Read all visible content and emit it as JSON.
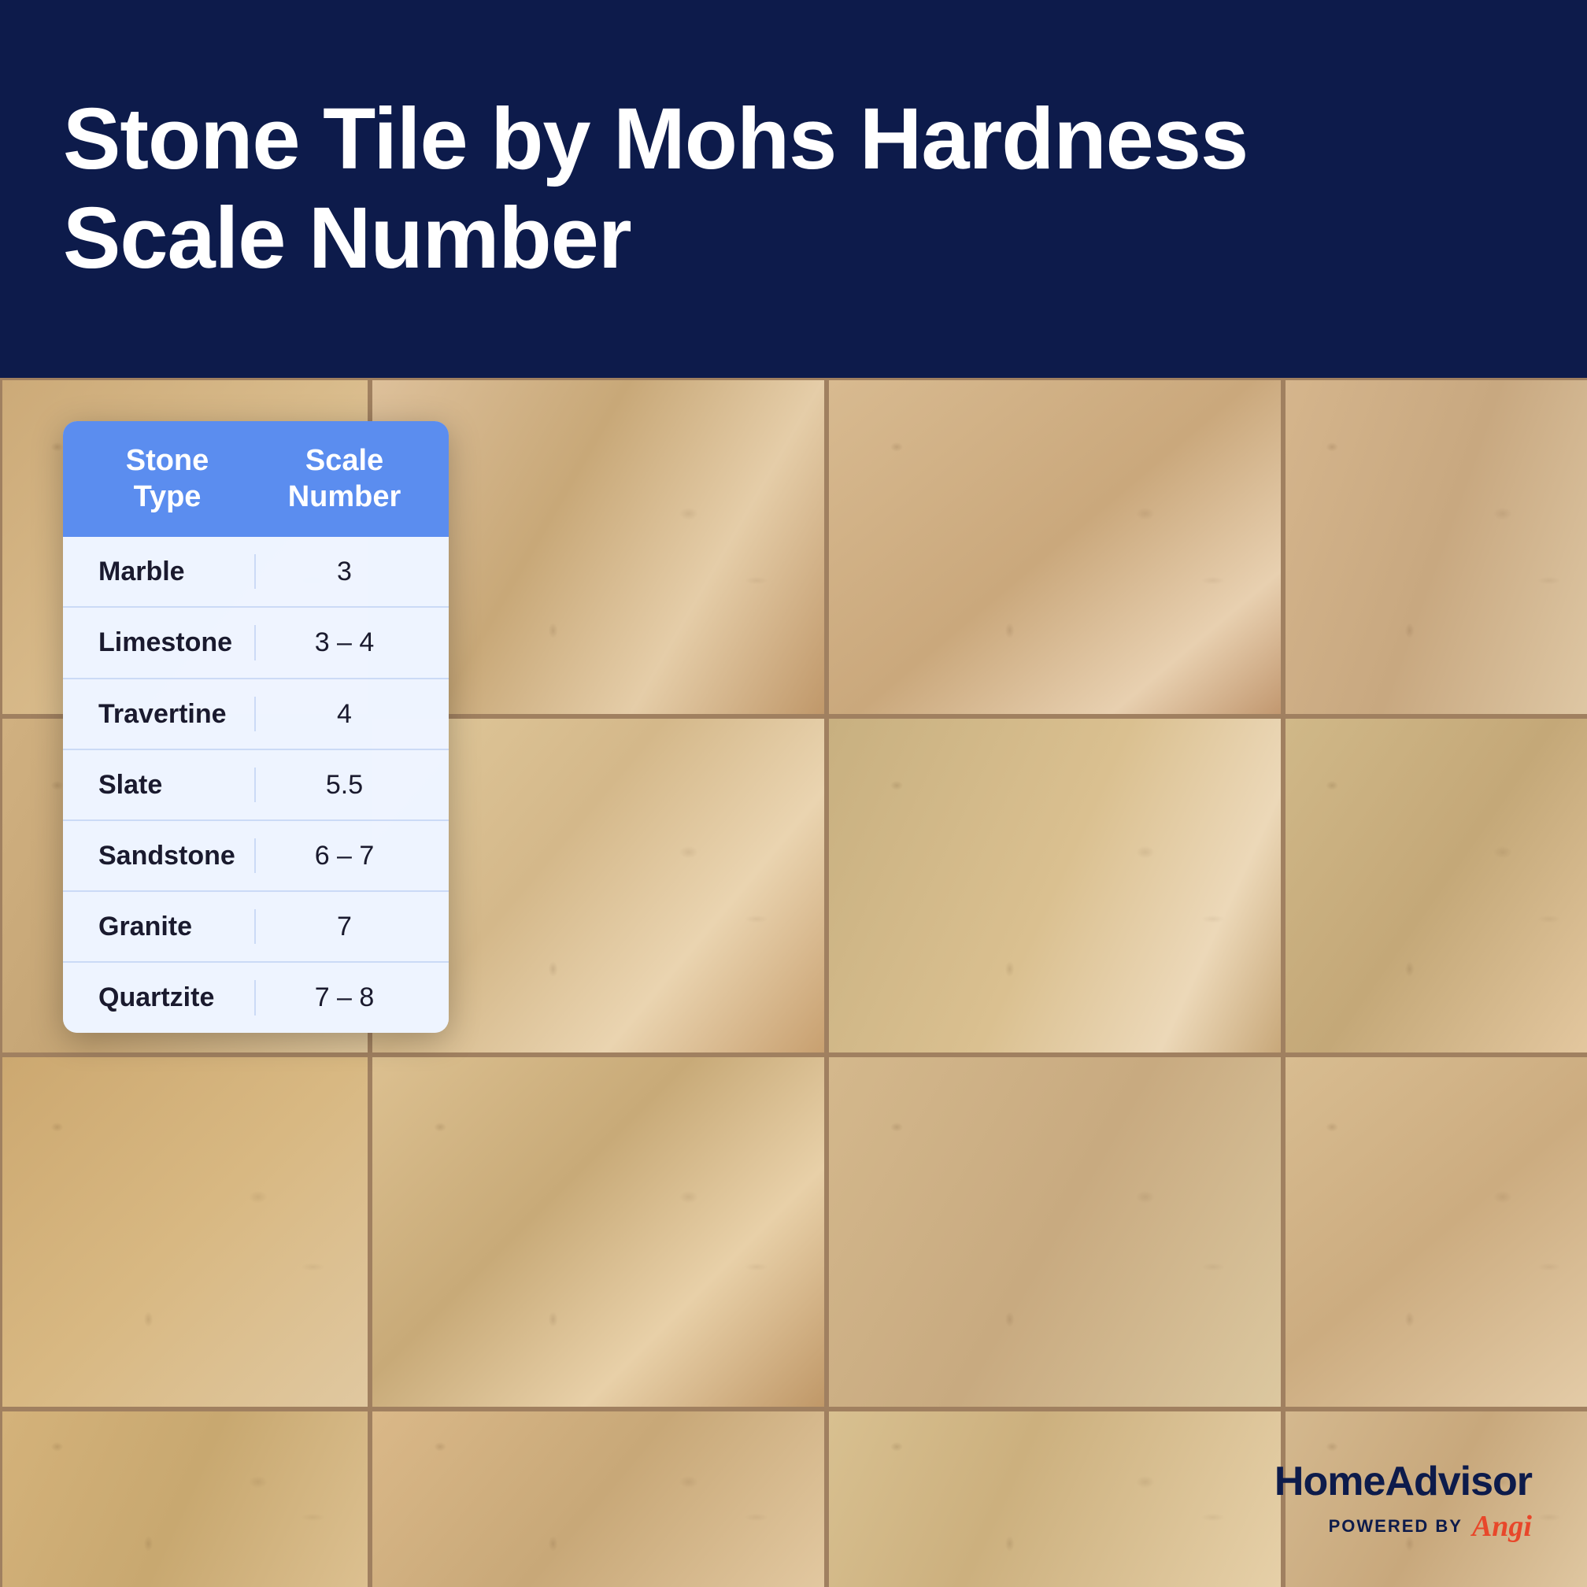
{
  "header": {
    "title_line1": "Stone Tile by Mohs Hardness",
    "title_line2": "Scale Number",
    "background_color": "#0d1b4b",
    "text_color": "#ffffff"
  },
  "table": {
    "col1_header_line1": "Stone",
    "col1_header_line2": "Type",
    "col2_header_line1": "Scale",
    "col2_header_line2": "Number",
    "header_bg": "#5b8def",
    "rows": [
      {
        "stone": "Marble",
        "scale": "3"
      },
      {
        "stone": "Limestone",
        "scale": "3 – 4"
      },
      {
        "stone": "Travertine",
        "scale": "4"
      },
      {
        "stone": "Slate",
        "scale": "5.5"
      },
      {
        "stone": "Sandstone",
        "scale": "6 – 7"
      },
      {
        "stone": "Granite",
        "scale": "7"
      },
      {
        "stone": "Quartzite",
        "scale": "7 – 8"
      }
    ]
  },
  "branding": {
    "company": "HomeAdvisor",
    "powered_by": "POWERED BY",
    "partner": "Angi"
  }
}
